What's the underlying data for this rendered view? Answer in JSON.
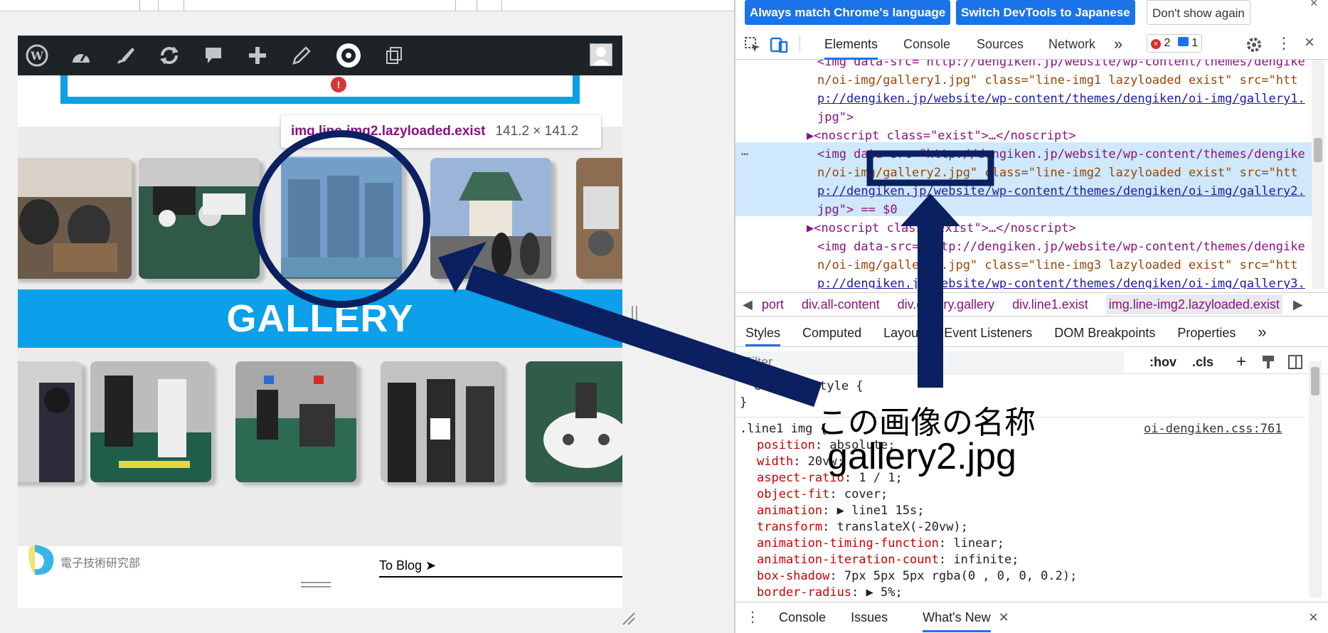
{
  "wp_toolbar": {
    "icons": [
      "wordpress-icon",
      "dashboard-icon",
      "customize-icon",
      "updates-icon",
      "comments-icon",
      "new-content-icon",
      "edit-icon",
      "plugin-icon",
      "copy-icon"
    ],
    "notification_badge": "!"
  },
  "tooltip": {
    "selector": "img.line-img2.lazyloaded.exist",
    "dimensions": "141.2 × 141.2"
  },
  "gallery": {
    "banner": "GALLERY"
  },
  "footer": {
    "org_name": "電子技術研究部",
    "blog_link": "To Blog ➤"
  },
  "devtools": {
    "lang_bar": {
      "match_lang": "Always match Chrome's language",
      "switch_jp": "Switch DevTools to Japanese",
      "dont_show": "Don't show again"
    },
    "tabs": {
      "elements": "Elements",
      "console": "Console",
      "sources": "Sources",
      "network": "Network",
      "more": "»"
    },
    "counts": {
      "errors": "2",
      "messages": "1"
    },
    "dom_lines": [
      "<img data-src=\"http://dengiken.jp/website/wp-content/themes/dengike",
      "n/oi-img/gallery1.jpg\" class=\"line-img1 lazyloaded exist\" src=\"htt",
      "p://dengiken.jp/website/wp-content/themes/dengiken/oi-img/gallery1.",
      "jpg\">",
      "▶<noscript class=\"exist\">…</noscript>",
      "<img data-src=\"http://dengiken.jp/website/wp-content/themes/dengike",
      "n/oi-img/gallery2.jpg\" class=\"line-img2 lazyloaded exist\" src=\"htt",
      "p://dengiken.jp/website/wp-content/themes/dengiken/oi-img/gallery2.",
      "jpg\"> == $0",
      "▶<noscript class=\"exist\">…</noscript>",
      "<img data-src=\"http://dengiken.jp/website/wp-content/themes/dengike",
      "n/oi-img/gallery3.jpg\" class=\"line-img3 lazyloaded exist\" src=\"htt",
      "p://dengiken.jp/website/wp-content/themes/dengiken/oi-img/gallery3."
    ],
    "breadcrumbs": [
      "port",
      "div.all-content",
      "div.gallery.gallery",
      "div.line1.exist",
      "img.line-img2.lazyloaded.exist"
    ],
    "subtabs": [
      "Styles",
      "Computed",
      "Layout",
      "Event Listeners",
      "DOM Breakpoints",
      "Properties",
      "»"
    ],
    "filter": {
      "placeholder": "Filter",
      "hov": ":hov",
      "cls": ".cls"
    },
    "styles": {
      "element_style": "element.style {",
      "close": "}",
      "rule_selector": ".line1 img {",
      "source": "oi-dengiken.css:761",
      "props": [
        [
          "position",
          "absolute;"
        ],
        [
          "width",
          "20vw;"
        ],
        [
          "aspect-ratio",
          "1 / 1;"
        ],
        [
          "object-fit",
          "cover;"
        ],
        [
          "animation",
          "▶ line1 15s;"
        ],
        [
          "transform",
          "translateX(-20vw);"
        ],
        [
          "animation-timing-function",
          "linear;"
        ],
        [
          "animation-iteration-count",
          "infinite;"
        ],
        [
          "box-shadow",
          "7px 5px 5px rgba(0 , 0, 0, 0.2);"
        ],
        [
          "border-radius",
          "▶ 5%;"
        ]
      ]
    },
    "drawer": {
      "console": "Console",
      "issues": "Issues",
      "whats_new": "What's New"
    }
  },
  "annotation": {
    "line1": "この画像の名称",
    "line2": "gallery2.jpg",
    "color": "#0a2060"
  }
}
